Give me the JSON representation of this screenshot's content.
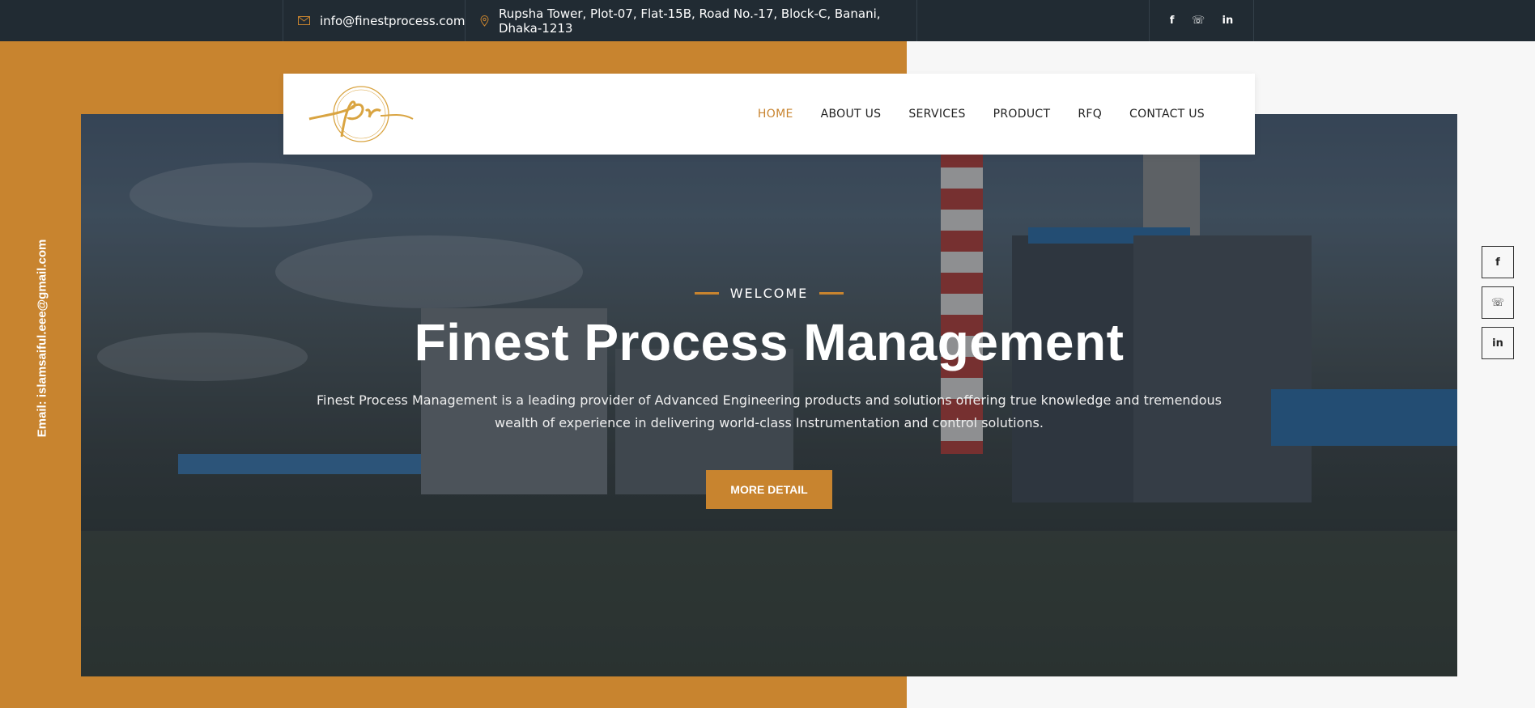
{
  "topbar": {
    "email": "info@finestprocess.com",
    "address": "Rupsha Tower, Plot-07, Flat-15B, Road No.-17, Block-C, Banani, Dhaka-1213",
    "social": {
      "facebook": "f",
      "whatsapp": "☏",
      "linkedin": "in"
    }
  },
  "navbar": {
    "items": [
      {
        "label": "HOME",
        "active": true
      },
      {
        "label": "ABOUT US"
      },
      {
        "label": "SERVICES"
      },
      {
        "label": "PRODUCT"
      },
      {
        "label": "RFQ"
      },
      {
        "label": "CONTACT US"
      }
    ]
  },
  "hero": {
    "welcome": "WELCOME",
    "title": "Finest Process Management",
    "description": "Finest Process Management is a leading provider of Advanced Engineering products and solutions offering true knowledge and tremendous wealth of experience in delivering world-class Instrumentation and control solutions.",
    "button": "MORE DETAIL"
  },
  "sidebar_email": "Email: islamsaiful.eee@gmail.com",
  "side_social": {
    "facebook": "f",
    "whatsapp": "☏",
    "linkedin": "in"
  },
  "colors": {
    "accent": "#c8842f",
    "topbar": "#212b33"
  }
}
